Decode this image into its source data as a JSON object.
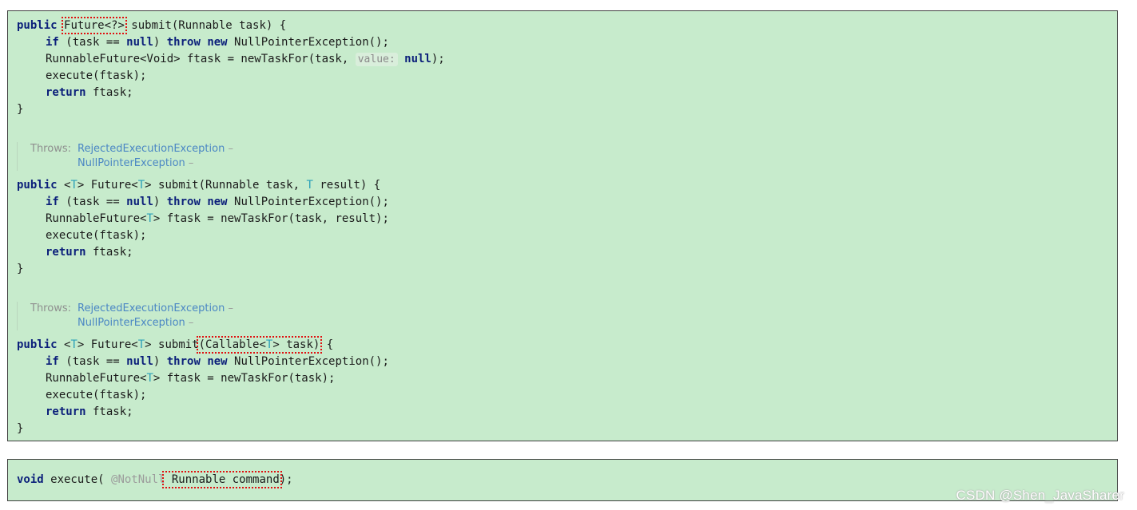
{
  "code_block_1": {
    "line1": {
      "kw_public": "public",
      "return_type": "Future<?>",
      "rest": " submit(Runnable task) {"
    },
    "line2": {
      "kw_if": "if",
      "cond": " (task == ",
      "kw_null": "null",
      "close": ") ",
      "kw_throw": "throw",
      "kw_new": "new",
      "exc": " NullPointerException();"
    },
    "line3": {
      "decl": "RunnableFuture<Void> ftask = newTaskFor(task, ",
      "hint": "value:",
      "kw_null": "null",
      "end": ");"
    },
    "line4": "execute(ftask);",
    "line5": {
      "kw_return": "return",
      "rest": " ftask;"
    },
    "line6": "}"
  },
  "doc_1": {
    "label": "Throws:",
    "exc1": "RejectedExecutionException",
    "dash": " –",
    "exc2": "NullPointerException"
  },
  "code_block_2": {
    "line1": {
      "kw_public": "public",
      "lt": " <",
      "T": "T",
      "gt_future": "> Future<",
      "gt_submit": "> submit(Runnable task, ",
      "result": " result) {"
    },
    "line2": {
      "kw_if": "if",
      "cond": " (task == ",
      "kw_null": "null",
      "close": ") ",
      "kw_throw": "throw",
      "kw_new": "new",
      "exc": " NullPointerException();"
    },
    "line3": {
      "pre": "RunnableFuture<",
      "T": "T",
      "post": "> ftask = newTaskFor(task, result);"
    },
    "line4": "execute(ftask);",
    "line5": {
      "kw_return": "return",
      "rest": " ftask;"
    },
    "line6": "}"
  },
  "doc_2": {
    "label": "Throws:",
    "exc1": "RejectedExecutionException",
    "dash": " –",
    "exc2": "NullPointerException"
  },
  "code_block_3": {
    "line1": {
      "kw_public": "public",
      "lt": " <",
      "T": "T",
      "gt_future": "> Future<",
      "gt_submit": "> submit",
      "param_pre": "(Callable<",
      "param_post": "> task)",
      "open": " {"
    },
    "line2": {
      "kw_if": "if",
      "cond": " (task == ",
      "kw_null": "null",
      "close": ") ",
      "kw_throw": "throw",
      "kw_new": "new",
      "exc": " NullPointerException();"
    },
    "line3": {
      "pre": "RunnableFuture<",
      "T": "T",
      "post": "> ftask = newTaskFor(task);"
    },
    "line4": "execute(ftask);",
    "line5": {
      "kw_return": "return",
      "rest": " ftask;"
    },
    "line6": "}"
  },
  "execute_panel": {
    "kw_void": "void",
    "name": " execute( ",
    "annotation": "@NotNull",
    "param": " Runnable command",
    "end": ");"
  },
  "watermark": "CSDN @Shen_JavaSharer",
  "colors": {
    "panel_bg": "#c7ebcc",
    "keyword": "#0b1f7a",
    "type_param": "#2aa0b8",
    "doc_link": "#4b87c4",
    "highlight_box": "#e01010"
  }
}
